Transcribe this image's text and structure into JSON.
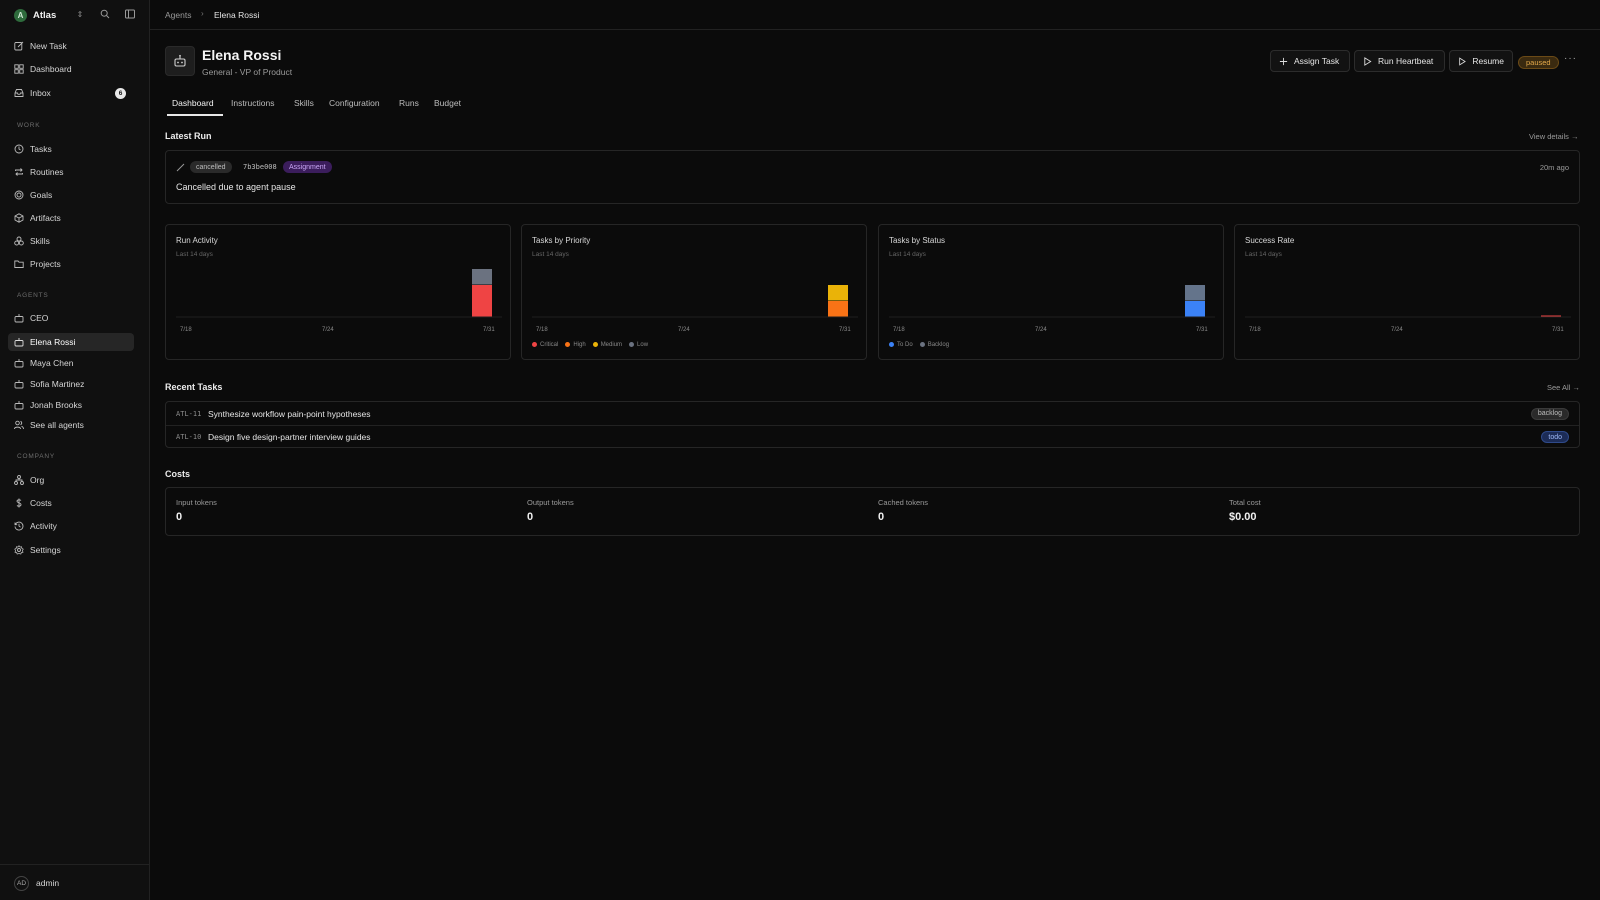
{
  "workspace": {
    "name": "Atlas",
    "logo_letter": "A"
  },
  "sidebar": {
    "top_items": [
      {
        "label": "New Task",
        "icon": "edit-icon"
      },
      {
        "label": "Dashboard",
        "icon": "dashboard-icon"
      },
      {
        "label": "Inbox",
        "icon": "inbox-icon",
        "count": "6"
      }
    ],
    "sections": {
      "work": "WORK",
      "agents": "AGENTS",
      "company": "COMPANY"
    },
    "work_items": [
      {
        "label": "Tasks",
        "icon": "circle-icon"
      },
      {
        "label": "Routines",
        "icon": "repeat-icon"
      },
      {
        "label": "Goals",
        "icon": "target-icon"
      },
      {
        "label": "Artifacts",
        "icon": "box-icon"
      },
      {
        "label": "Skills",
        "icon": "shapes-icon"
      },
      {
        "label": "Projects",
        "icon": "folder-icon"
      }
    ],
    "agent_items": [
      {
        "label": "CEO",
        "icon": "bot-icon"
      },
      {
        "label": "Elena Rossi",
        "icon": "bot-icon",
        "active": true
      },
      {
        "label": "Maya Chen",
        "icon": "bot-icon"
      },
      {
        "label": "Sofia Martinez",
        "icon": "bot-icon"
      },
      {
        "label": "Jonah Brooks",
        "icon": "bot-icon"
      },
      {
        "label": "See all agents",
        "icon": "users-icon"
      }
    ],
    "company_items": [
      {
        "label": "Org",
        "icon": "org-icon"
      },
      {
        "label": "Costs",
        "icon": "dollar-icon"
      },
      {
        "label": "Activity",
        "icon": "history-icon"
      },
      {
        "label": "Settings",
        "icon": "gear-icon"
      }
    ],
    "user": {
      "initials": "AD",
      "name": "admin"
    }
  },
  "breadcrumb": {
    "parent": "Agents",
    "separator": "›",
    "current": "Elena Rossi"
  },
  "agent": {
    "name": "Elena Rossi",
    "role": "General - VP of Product",
    "status": "paused"
  },
  "actions": {
    "assign_task": "Assign Task",
    "run_heartbeat": "Run Heartbeat",
    "resume": "Resume",
    "more": "···"
  },
  "tabs": [
    "Dashboard",
    "Instructions",
    "Skills",
    "Configuration",
    "Runs",
    "Budget"
  ],
  "latest_run": {
    "title": "Latest Run",
    "view_details": "View details →",
    "status": "cancelled",
    "run_id": "7b3be008",
    "tag": "Assignment",
    "time_ago": "20m ago",
    "message": "Cancelled due to agent pause"
  },
  "charts": [
    {
      "title": "Run Activity",
      "subtitle": "Last 14 days",
      "chart_data": {
        "type": "bar",
        "categories": [
          "7/18",
          "7/31"
        ],
        "series": [
          {
            "color": "#ef4444",
            "values": [
              0,
              2
            ]
          },
          {
            "color": "#6b7280",
            "values": [
              0,
              1
            ]
          }
        ]
      },
      "ticks": [
        "7/18",
        "7/24",
        "7/31"
      ]
    },
    {
      "title": "Tasks by Priority",
      "subtitle": "Last 14 days",
      "chart_data": {
        "type": "bar",
        "categories": [
          "7/18",
          "7/31"
        ],
        "series": [
          {
            "name": "High",
            "color": "#f97316",
            "values": [
              0,
              1
            ]
          },
          {
            "name": "Medium",
            "color": "#eab308",
            "values": [
              0,
              1
            ]
          }
        ]
      },
      "ticks": [
        "7/18",
        "7/24",
        "7/31"
      ],
      "legend": [
        {
          "label": "Critical",
          "color": "#ef4444"
        },
        {
          "label": "High",
          "color": "#f97316"
        },
        {
          "label": "Medium",
          "color": "#eab308"
        },
        {
          "label": "Low",
          "color": "#6b7280"
        }
      ]
    },
    {
      "title": "Tasks by Status",
      "subtitle": "Last 14 days",
      "chart_data": {
        "type": "bar",
        "categories": [
          "7/18",
          "7/31"
        ],
        "series": [
          {
            "name": "To Do",
            "color": "#3b82f6",
            "values": [
              0,
              1
            ]
          },
          {
            "name": "Backlog",
            "color": "#64748b",
            "values": [
              0,
              1
            ]
          }
        ]
      },
      "ticks": [
        "7/18",
        "7/24",
        "7/31"
      ],
      "legend": [
        {
          "label": "To Do",
          "color": "#3b82f6"
        },
        {
          "label": "Backlog",
          "color": "#6b7280"
        }
      ]
    },
    {
      "title": "Success Rate",
      "subtitle": "Last 14 days",
      "chart_data": {
        "type": "bar",
        "categories": [
          "7/18",
          "7/31"
        ],
        "series": [
          {
            "color": "#ef4444",
            "values": [
              0,
              0
            ]
          }
        ]
      },
      "ticks": [
        "7/18",
        "7/24",
        "7/31"
      ]
    }
  ],
  "recent_tasks": {
    "title": "Recent Tasks",
    "see_all": "See All →",
    "rows": [
      {
        "id": "ATL-11",
        "title": "Synthesize workflow pain-point hypotheses",
        "status": "backlog"
      },
      {
        "id": "ATL-10",
        "title": "Design five design-partner interview guides",
        "status": "todo"
      }
    ]
  },
  "costs": {
    "title": "Costs",
    "items": [
      {
        "label": "Input tokens",
        "value": "0"
      },
      {
        "label": "Output tokens",
        "value": "0"
      },
      {
        "label": "Cached tokens",
        "value": "0"
      },
      {
        "label": "Total cost",
        "value": "$0.00"
      }
    ]
  }
}
